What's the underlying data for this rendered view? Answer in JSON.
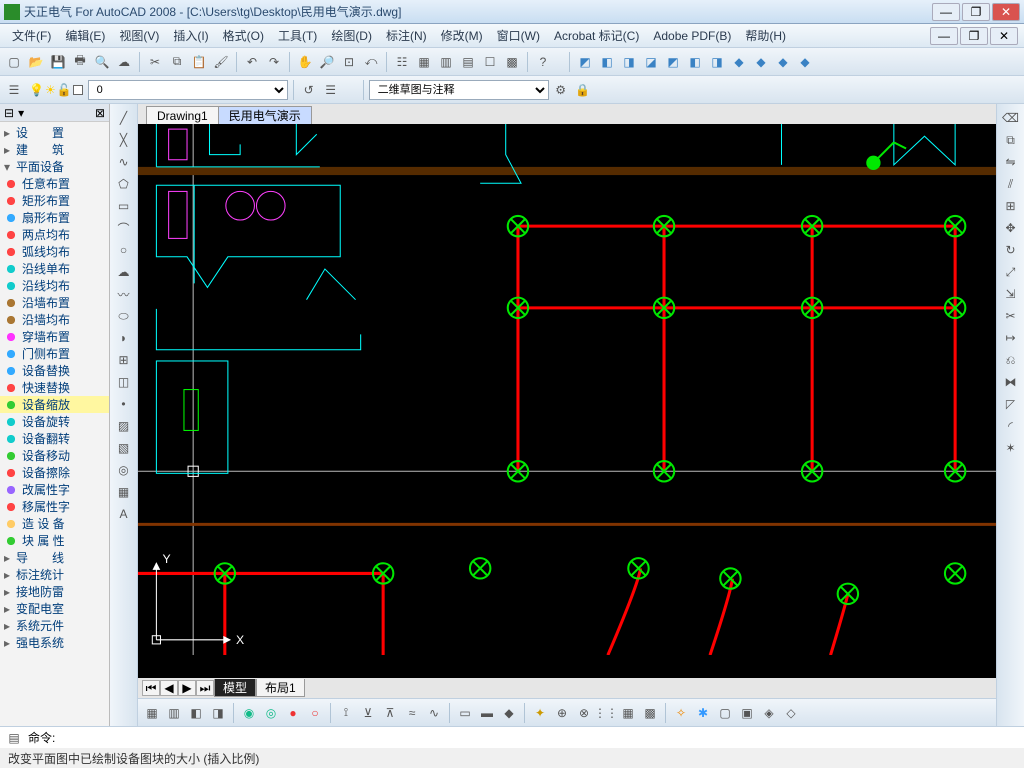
{
  "window": {
    "title": "天正电气 For AutoCAD 2008 - [C:\\Users\\tg\\Desktop\\民用电气演示.dwg]"
  },
  "menu": [
    "文件(F)",
    "编辑(E)",
    "视图(V)",
    "插入(I)",
    "格式(O)",
    "工具(T)",
    "绘图(D)",
    "标注(N)",
    "修改(M)",
    "窗口(W)",
    "Acrobat 标记(C)",
    "Adobe PDF(B)",
    "帮助(H)"
  ],
  "layer_combo": "0",
  "anno_combo": "二维草图与注释",
  "doc_tabs": {
    "items": [
      "Drawing1",
      "民用电气演示"
    ],
    "active": 1
  },
  "model_tabs": {
    "items": [
      "模型",
      "布局1"
    ],
    "active": 0
  },
  "axis": {
    "x": "X",
    "y": "Y"
  },
  "sidebar": {
    "categories": [
      {
        "label": "设　　置",
        "expandable": true
      },
      {
        "label": "建　　筑",
        "expandable": true
      },
      {
        "label": "平面设备",
        "expandable": true,
        "expanded": true
      }
    ],
    "items": [
      {
        "icon": "ci-red",
        "label": "任意布置"
      },
      {
        "icon": "ci-red",
        "label": "矩形布置"
      },
      {
        "icon": "ci-blue",
        "label": "扇形布置"
      },
      {
        "icon": "ci-red",
        "label": "两点均布"
      },
      {
        "icon": "ci-red",
        "label": "弧线均布"
      },
      {
        "icon": "ci-teal",
        "label": "沿线单布"
      },
      {
        "icon": "ci-teal",
        "label": "沿线均布"
      },
      {
        "icon": "ci-brn",
        "label": "沿墙布置"
      },
      {
        "icon": "ci-brn",
        "label": "沿墙均布"
      },
      {
        "icon": "ci-mg",
        "label": "穿墙布置"
      },
      {
        "icon": "ci-blue",
        "label": "门侧布置"
      },
      {
        "icon": "ci-blue",
        "label": "设备替换"
      },
      {
        "icon": "ci-red",
        "label": "快速替换"
      },
      {
        "icon": "ci-green",
        "label": "设备缩放",
        "selected": true
      },
      {
        "icon": "ci-teal",
        "label": "设备旋转"
      },
      {
        "icon": "ci-teal",
        "label": "设备翻转"
      },
      {
        "icon": "ci-green",
        "label": "设备移动"
      },
      {
        "icon": "ci-red",
        "label": "设备擦除"
      },
      {
        "icon": "ci-pur",
        "label": "改属性字"
      },
      {
        "icon": "ci-red",
        "label": "移属性字"
      },
      {
        "icon": "ci-gold",
        "label": "造 设 备"
      },
      {
        "icon": "ci-green",
        "label": "块 属 性"
      }
    ],
    "categories_bottom": [
      {
        "label": "导　　线"
      },
      {
        "label": "标注统计"
      },
      {
        "label": "接地防雷"
      },
      {
        "label": "变配电室"
      },
      {
        "label": "系统元件"
      },
      {
        "label": "强电系统"
      }
    ]
  },
  "cmd": {
    "label": "命令:",
    "value": ""
  },
  "status": "改变平面图中已绘制设备图块的大小 (插入比例)"
}
